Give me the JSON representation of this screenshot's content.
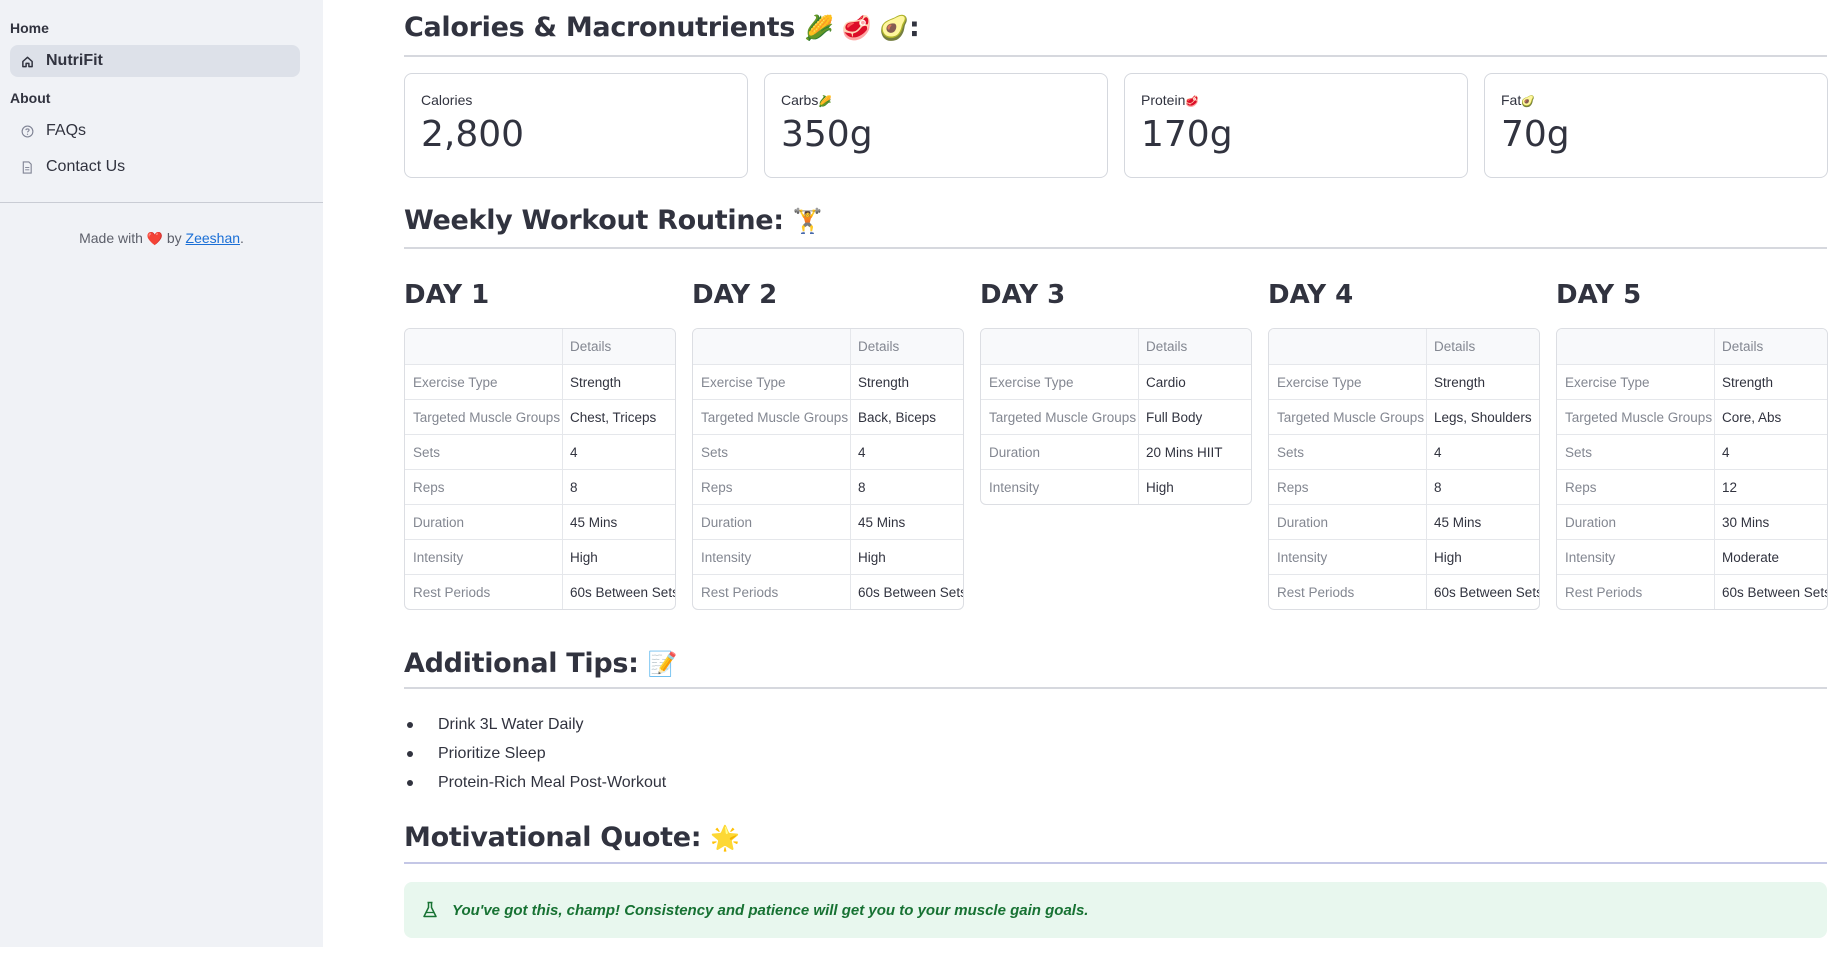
{
  "sidebar": {
    "section_home": "Home",
    "nav_active": "NutriFit",
    "section_about": "About",
    "faqs": "FAQs",
    "contact": "Contact Us",
    "made_with_prefix": "Made with",
    "made_with_heart": "❤️",
    "made_with_by": "by",
    "author": "Zeeshan",
    "made_with_suffix": "."
  },
  "macros": {
    "heading": "Calories & Macronutrients",
    "heading_emojis": "🌽 🥩 🥑",
    "heading_suffix": ":",
    "cards": [
      {
        "label": "Calories",
        "emoji": "",
        "value": "2,800"
      },
      {
        "label": "Carbs",
        "emoji": "🌽",
        "value": "350g"
      },
      {
        "label": "Protein",
        "emoji": "🥩",
        "value": "170g"
      },
      {
        "label": "Fat",
        "emoji": "🥑",
        "value": "70g"
      }
    ]
  },
  "workout": {
    "heading": "Weekly Workout Routine:",
    "heading_emoji": "🏋️",
    "header_col": "Details",
    "days": [
      {
        "title": "DAY 1",
        "rows": [
          [
            "Exercise Type",
            "Strength"
          ],
          [
            "Targeted Muscle Groups",
            "Chest, Triceps"
          ],
          [
            "Sets",
            "4"
          ],
          [
            "Reps",
            "8"
          ],
          [
            "Duration",
            "45 Mins"
          ],
          [
            "Intensity",
            "High"
          ],
          [
            "Rest Periods",
            "60s Between Sets"
          ]
        ]
      },
      {
        "title": "DAY 2",
        "rows": [
          [
            "Exercise Type",
            "Strength"
          ],
          [
            "Targeted Muscle Groups",
            "Back, Biceps"
          ],
          [
            "Sets",
            "4"
          ],
          [
            "Reps",
            "8"
          ],
          [
            "Duration",
            "45 Mins"
          ],
          [
            "Intensity",
            "High"
          ],
          [
            "Rest Periods",
            "60s Between Sets"
          ]
        ]
      },
      {
        "title": "DAY 3",
        "rows": [
          [
            "Exercise Type",
            "Cardio"
          ],
          [
            "Targeted Muscle Groups",
            "Full Body"
          ],
          [
            "Duration",
            "20 Mins HIIT"
          ],
          [
            "Intensity",
            "High"
          ]
        ]
      },
      {
        "title": "DAY 4",
        "rows": [
          [
            "Exercise Type",
            "Strength"
          ],
          [
            "Targeted Muscle Groups",
            "Legs, Shoulders"
          ],
          [
            "Sets",
            "4"
          ],
          [
            "Reps",
            "8"
          ],
          [
            "Duration",
            "45 Mins"
          ],
          [
            "Intensity",
            "High"
          ],
          [
            "Rest Periods",
            "60s Between Sets"
          ]
        ]
      },
      {
        "title": "DAY 5",
        "rows": [
          [
            "Exercise Type",
            "Strength"
          ],
          [
            "Targeted Muscle Groups",
            "Core, Abs"
          ],
          [
            "Sets",
            "4"
          ],
          [
            "Reps",
            "12"
          ],
          [
            "Duration",
            "30 Mins"
          ],
          [
            "Intensity",
            "Moderate"
          ],
          [
            "Rest Periods",
            "60s Between Sets"
          ]
        ]
      }
    ]
  },
  "tips": {
    "heading": "Additional Tips:",
    "heading_emoji": "📝",
    "items": [
      "Drink 3L Water Daily",
      "Prioritize Sleep",
      "Protein-Rich Meal Post-Workout"
    ]
  },
  "quote": {
    "heading": "Motivational Quote:",
    "heading_emoji": "🌟",
    "text": "You've got this, champ! Consistency and patience will get you to your muscle gain goals."
  }
}
